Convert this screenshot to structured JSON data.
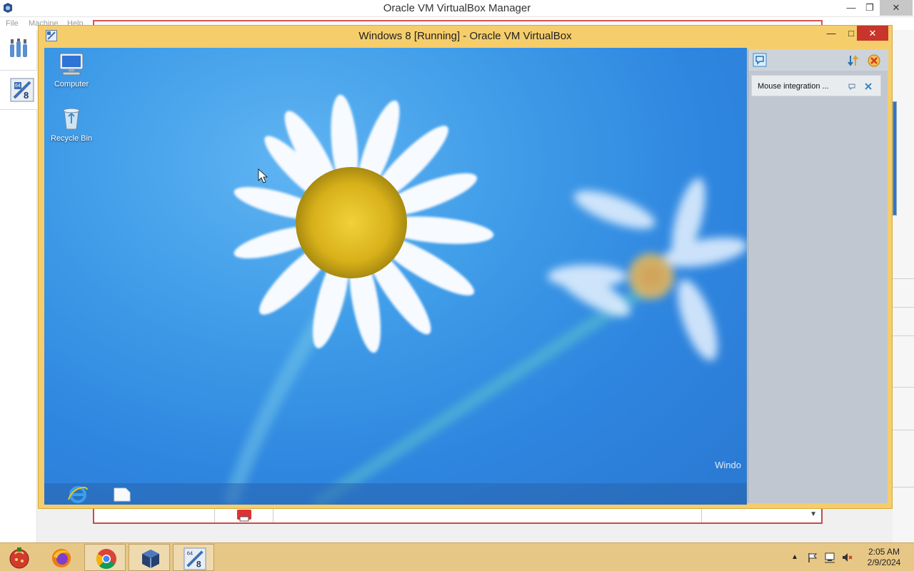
{
  "manager": {
    "title": "Oracle VM VirtualBox Manager",
    "menu": [
      "File",
      "Machine",
      "Help"
    ],
    "controls": {
      "minimize": "—",
      "restore": "❐",
      "close": "✕"
    }
  },
  "vm_window": {
    "title": "Windows 8 [Running] - Oracle VM VirtualBox",
    "controls": {
      "minimize": "—",
      "maximize": "□",
      "close": "✕"
    }
  },
  "guest": {
    "desktop_icons": [
      {
        "label": "Computer",
        "icon": "computer-icon"
      },
      {
        "label": "Recycle Bin",
        "icon": "recycle-bin-icon"
      }
    ],
    "watermark": "Windo",
    "taskbar": [
      "internet-explorer-icon",
      "file-explorer-icon"
    ]
  },
  "notification": {
    "text": "Mouse integration ..."
  },
  "host_taskbar": {
    "apps": [
      "start-orb-icon",
      "firefox-icon",
      "chrome-icon",
      "virtualbox-icon",
      "windows8-vm-icon"
    ],
    "clock_time": "2:05 AM",
    "clock_date": "2/9/2024"
  }
}
